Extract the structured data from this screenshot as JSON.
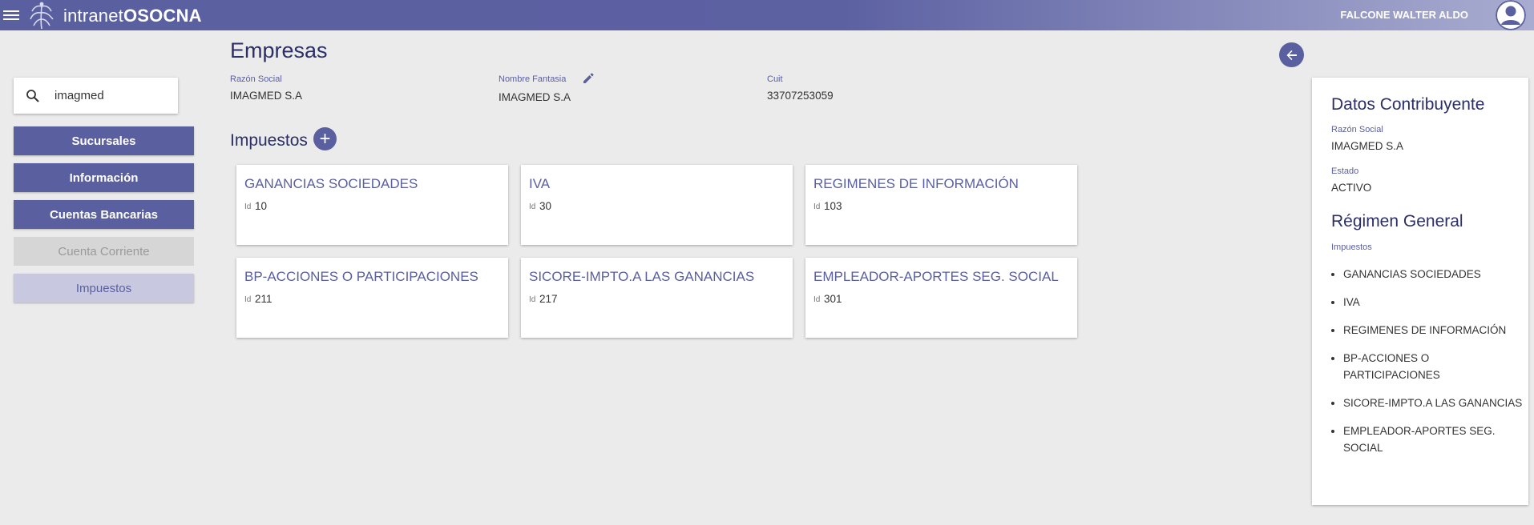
{
  "topbar": {
    "logo_prefix": "intranet",
    "logo_brand": "OSOCNA",
    "user_name": "FALCONE WALTER ALDO"
  },
  "sidebar": {
    "search_value": "imagmed",
    "buttons": [
      {
        "label": "Sucursales"
      },
      {
        "label": "Información"
      },
      {
        "label": "Cuentas Bancarias"
      },
      {
        "label": "Cuenta Corriente"
      },
      {
        "label": "Impuestos"
      }
    ]
  },
  "main": {
    "title": "Empresas",
    "fields": {
      "razon_social_label": "Razón Social",
      "razon_social_value": "IMAGMED S.A",
      "nombre_fantasia_label": "Nombre Fantasia",
      "nombre_fantasia_value": "IMAGMED S.A",
      "cuit_label": "Cuit",
      "cuit_value": "33707253059"
    },
    "impuestos_title": "Impuestos",
    "add_symbol": "+",
    "id_label": "Id",
    "cards": [
      {
        "title": "GANANCIAS SOCIEDADES",
        "id": "10"
      },
      {
        "title": "IVA",
        "id": "30"
      },
      {
        "title": "REGIMENES DE INFORMACIÓN",
        "id": "103"
      },
      {
        "title": "BP-ACCIONES O PARTICIPACIONES",
        "id": "211"
      },
      {
        "title": "SICORE-IMPTO.A LAS GANANCIAS",
        "id": "217"
      },
      {
        "title": "EMPLEADOR-APORTES SEG. SOCIAL",
        "id": "301"
      }
    ]
  },
  "right_panel": {
    "title": "Datos Contribuyente",
    "razon_social_label": "Razón Social",
    "razon_social_value": "IMAGMED S.A",
    "estado_label": "Estado",
    "estado_value": "ACTIVO",
    "regimen_title": "Régimen General",
    "impuestos_label": "Impuestos",
    "impuestos": [
      "GANANCIAS SOCIEDADES",
      "IVA",
      "REGIMENES DE INFORMACIÓN",
      "BP-ACCIONES O PARTICIPACIONES",
      "SICORE-IMPTO.A LAS GANANCIAS",
      "EMPLEADOR-APORTES SEG. SOCIAL"
    ]
  },
  "icons": {
    "menu": "menu-icon",
    "logo": "logo-mark-icon",
    "avatar": "user-avatar-icon",
    "search": "search-icon",
    "edit": "edit-pencil-icon",
    "add": "add-circle-icon",
    "back": "arrow-back-icon"
  },
  "colors": {
    "primary": "#5a5fa0",
    "title": "#2b2f66",
    "background": "#ebebeb",
    "disabled": "#d6d6d6",
    "active_button": "#c8c8e0"
  }
}
